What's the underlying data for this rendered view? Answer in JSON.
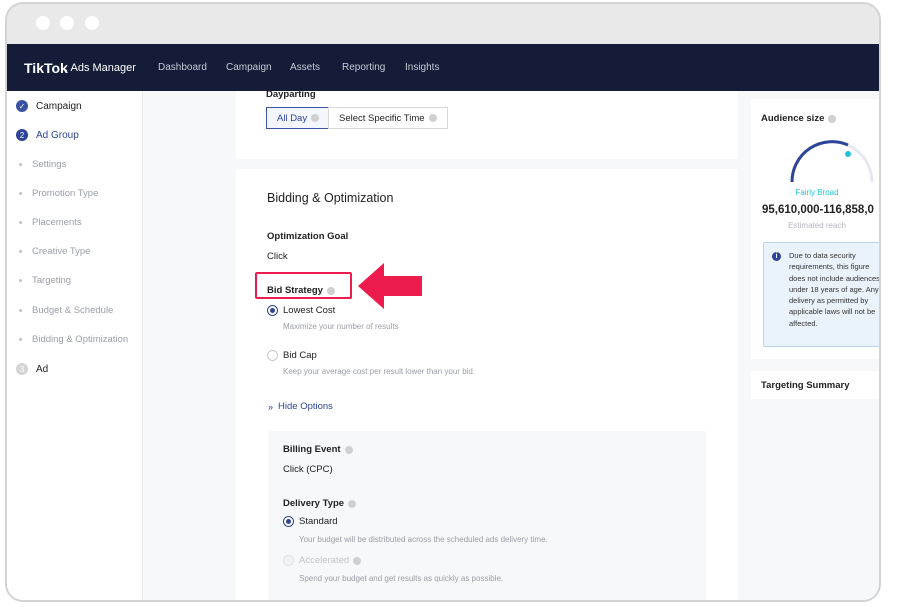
{
  "window": {
    "controls": [
      "close",
      "minimize",
      "zoom"
    ]
  },
  "navbar": {
    "logo": "TikTok",
    "logo_sub": ": Ads Manager",
    "links": [
      "Dashboard",
      "Campaign",
      "Assets",
      "Reporting",
      "Insights"
    ]
  },
  "sidebar": {
    "steps": [
      {
        "label": "Campaign",
        "state": "done",
        "icon": "check-icon"
      },
      {
        "label": "Ad Group",
        "state": "active",
        "number": "2"
      },
      {
        "label": "Ad",
        "state": "future",
        "number": "3"
      }
    ],
    "substeps": [
      "Settings",
      "Promotion Type",
      "Placements",
      "Creative Type",
      "Targeting",
      "Budget & Schedule",
      "Bidding & Optimization"
    ]
  },
  "dayparting": {
    "label": "Dayparting",
    "options": [
      "All Day",
      "Select Specific Time"
    ],
    "selected": "All Day"
  },
  "bidding": {
    "title": "Bidding & Optimization",
    "optimization_goal_label": "Optimization Goal",
    "optimization_goal_value": "Click",
    "bid_strategy_label": "Bid Strategy",
    "strategies": [
      {
        "label": "Lowest Cost",
        "desc": "Maximize your number of results",
        "selected": true
      },
      {
        "label": "Bid Cap",
        "desc": "Keep your average cost per result lower than your bid.",
        "selected": false
      }
    ],
    "hide_options": "Hide Options",
    "billing_event_label": "Billing Event",
    "billing_event_value": "Click (CPC)",
    "delivery_type_label": "Delivery Type",
    "delivery": [
      {
        "label": "Standard",
        "desc": "Your budget will be distributed across the scheduled ads delivery time.",
        "selected": true
      },
      {
        "label": "Accelerated",
        "desc": "Spend your budget and get results as quickly as possible.",
        "selected": false,
        "disabled": true
      }
    ]
  },
  "audience": {
    "title": "Audience size",
    "status": "Fairly Broad",
    "range": "95,610,000-116,858,0",
    "estimate_label": "Estimated reach",
    "notice": "Due to data security requirements, this figure does not include audiences under 18 years of age. Any delivery as permitted by applicable laws will not be affected.",
    "targeting_summary": "Targeting Summary"
  },
  "colors": {
    "nav_bg": "#141c38",
    "accent": "#2d4497",
    "highlight": "#ee1b4f",
    "gauge_accent": "#1fc4d6"
  }
}
